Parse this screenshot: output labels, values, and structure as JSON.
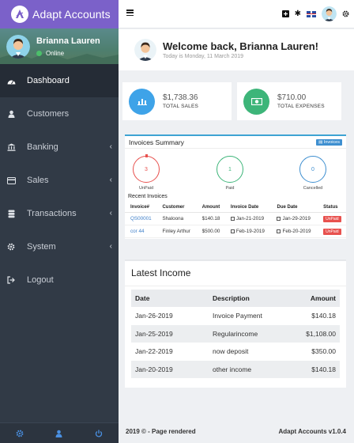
{
  "app": {
    "title": "Adapt Accounts"
  },
  "user": {
    "name": "Brianna Lauren",
    "status": "Online"
  },
  "sidebar": {
    "items": [
      {
        "label": "Dashboard",
        "icon": "dashboard-icon"
      },
      {
        "label": "Customers",
        "icon": "user-icon"
      },
      {
        "label": "Banking",
        "icon": "bank-icon"
      },
      {
        "label": "Sales",
        "icon": "credit-card-icon"
      },
      {
        "label": "Transactions",
        "icon": "database-icon"
      },
      {
        "label": "System",
        "icon": "gear-icon"
      },
      {
        "label": "Logout",
        "icon": "logout-icon"
      }
    ]
  },
  "welcome": {
    "title": "Welcome back, Brianna Lauren!",
    "date": "Today is Monday, 11 March 2019"
  },
  "stats": {
    "sales": {
      "value": "$1,738.36",
      "label": "TOTAL SALES",
      "color": "#3ea3e8"
    },
    "expenses": {
      "value": "$710.00",
      "label": "TOTAL EXPENSES",
      "color": "#3db579"
    }
  },
  "invoices": {
    "title": "Invoices Summary",
    "badge": "Invoices",
    "circles": {
      "unpaid": {
        "count": "3",
        "label": "UnPaid",
        "color": "#e8514e"
      },
      "paid": {
        "count": "1",
        "label": "Paid",
        "color": "#3db579"
      },
      "cancelled": {
        "count": "0",
        "label": "Cancelled",
        "color": "#3e8fd0"
      }
    },
    "recent_title": "Recent Invoices",
    "columns": [
      "Invoice#",
      "Customer",
      "Amount",
      "Invoice Date",
      "Due Date",
      "Status"
    ],
    "rows": [
      {
        "num": "QS00001",
        "customer": "Shaloona",
        "amount": "$140.18",
        "date": "Jan-21-2019",
        "due": "Jan-29-2019",
        "status": "UnPaid"
      },
      {
        "num": "cor 44",
        "customer": "Finley Arthur",
        "amount": "$500.00",
        "date": "Feb-19-2019",
        "due": "Feb-20-2019",
        "status": "UnPaid"
      }
    ]
  },
  "income": {
    "title": "Latest Income",
    "columns": [
      "Date",
      "Description",
      "Amount"
    ],
    "rows": [
      {
        "date": "Jan-26-2019",
        "desc": "Invoice Payment",
        "amount": "$140.18"
      },
      {
        "date": "Jan-25-2019",
        "desc": "Regularincome",
        "amount": "$1,108.00"
      },
      {
        "date": "Jan-22-2019",
        "desc": "now deposit",
        "amount": "$350.00"
      },
      {
        "date": "Jan-20-2019",
        "desc": "other income",
        "amount": "$140.18"
      }
    ]
  },
  "footer": {
    "left": "2019 © - Page rendered",
    "right": "Adapt Accounts v1.0.4"
  }
}
